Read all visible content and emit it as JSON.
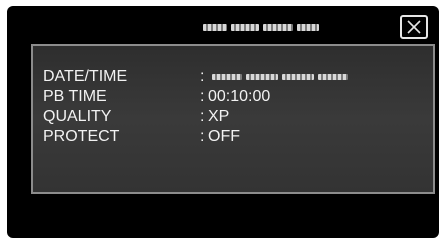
{
  "header": {
    "title_redacted": true,
    "close_icon": "close-icon"
  },
  "info": {
    "rows": [
      {
        "label": "DATE/TIME",
        "colon": ":",
        "value": ""
      },
      {
        "label": "PB TIME",
        "colon": ":",
        "value": "00:10:00"
      },
      {
        "label": "QUALITY",
        "colon": ":",
        "value": "XP"
      },
      {
        "label": "PROTECT",
        "colon": ":",
        "value": "OFF"
      }
    ]
  },
  "colors": {
    "background": "#000000",
    "panel_border": "#8c8c8c",
    "text": "#f2f2f2"
  }
}
